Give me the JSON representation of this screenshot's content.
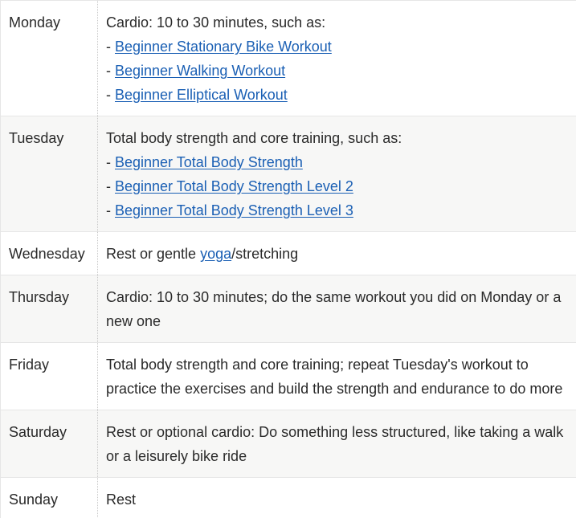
{
  "schedule": {
    "monday": {
      "day": "Monday",
      "intro": "Cardio: 10 to 30 minutes, such as:",
      "bullet": "- ",
      "links": [
        "Beginner Stationary Bike Workout",
        "Beginner Walking Workout",
        "Beginner Elliptical Workout"
      ]
    },
    "tuesday": {
      "day": "Tuesday",
      "intro": "Total body strength and core training, such as:",
      "bullet": "- ",
      "links": [
        "Beginner Total Body Strength",
        "Beginner Total Body Strength Level 2",
        "Beginner Total Body Strength Level 3"
      ]
    },
    "wednesday": {
      "day": "Wednesday",
      "before": "Rest or gentle ",
      "link": "yoga",
      "after": "/stretching"
    },
    "thursday": {
      "day": "Thursday",
      "text": "Cardio: 10 to 30 minutes; do the same workout you did on Monday or a new one"
    },
    "friday": {
      "day": "Friday",
      "text": "Total body strength and core training; repeat Tuesday's workout to practice the exercises and build the strength and endurance to do more"
    },
    "saturday": {
      "day": "Saturday",
      "text": "Rest or optional cardio: Do something less structured, like taking a walk or a leisurely bike ride"
    },
    "sunday": {
      "day": "Sunday",
      "text": "Rest"
    }
  }
}
